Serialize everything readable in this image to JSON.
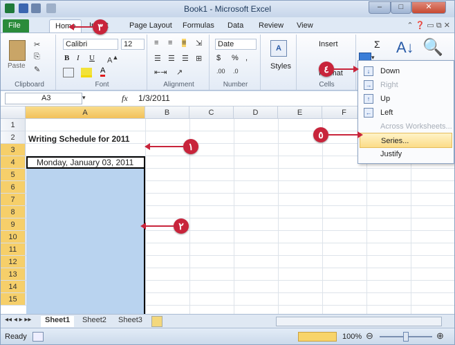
{
  "window": {
    "title": "Book1 - Microsoft Excel",
    "minimize": "–",
    "maximize": "□",
    "close": "✕"
  },
  "tabs": [
    "File",
    "Home",
    "Insert",
    "Page Layout",
    "Formulas",
    "Data",
    "Review",
    "View"
  ],
  "ribbon": {
    "clipboard": {
      "label": "Clipboard",
      "paste": "Paste"
    },
    "font": {
      "label": "Font",
      "name": "Calibri",
      "size": "12",
      "bold": "B",
      "italic": "I",
      "underline": "U"
    },
    "alignment": {
      "label": "Alignment"
    },
    "number": {
      "label": "Number",
      "format": "Date",
      "currency": "$",
      "percent": "%",
      "comma": ","
    },
    "styles": {
      "label": "Styles"
    },
    "cells": {
      "label": "Cells",
      "insert": "Insert",
      "format": "Format"
    },
    "editing": {
      "sum": "Σ",
      "sort": "Sort & Filter",
      "find": "Find &"
    }
  },
  "formula_bar": {
    "name_box": "A3",
    "fx": "fx",
    "value": "1/3/2011"
  },
  "columns": [
    "A",
    "B",
    "C",
    "D",
    "E",
    "F"
  ],
  "rows": [
    "1",
    "2",
    "3",
    "4",
    "5",
    "6",
    "7",
    "8",
    "9",
    "10",
    "11",
    "12",
    "13",
    "14",
    "15"
  ],
  "cells": {
    "A2": "Writing Schedule for 2011",
    "A3": "Monday, January 03, 2011"
  },
  "fill_menu": {
    "items": [
      {
        "label": "Down",
        "icon": "fill-down-icon",
        "enabled": true
      },
      {
        "label": "Right",
        "icon": "fill-right-icon",
        "enabled": false
      },
      {
        "label": "Up",
        "icon": "fill-up-icon",
        "enabled": true
      },
      {
        "label": "Left",
        "icon": "fill-left-icon",
        "enabled": true
      },
      {
        "label": "Across Worksheets...",
        "icon": "",
        "enabled": false
      },
      {
        "label": "Series...",
        "icon": "",
        "enabled": true
      },
      {
        "label": "Justify",
        "icon": "",
        "enabled": true
      }
    ]
  },
  "sheets": [
    "Sheet1",
    "Sheet2",
    "Sheet3"
  ],
  "status": {
    "ready": "Ready",
    "zoom": "100%"
  },
  "callouts": [
    "١",
    "٢",
    "٣",
    "٤",
    "٥"
  ],
  "colors": {
    "accent": "#c8243b",
    "selection": "#b9d3ef",
    "header_selected": "#f6cf6a"
  }
}
